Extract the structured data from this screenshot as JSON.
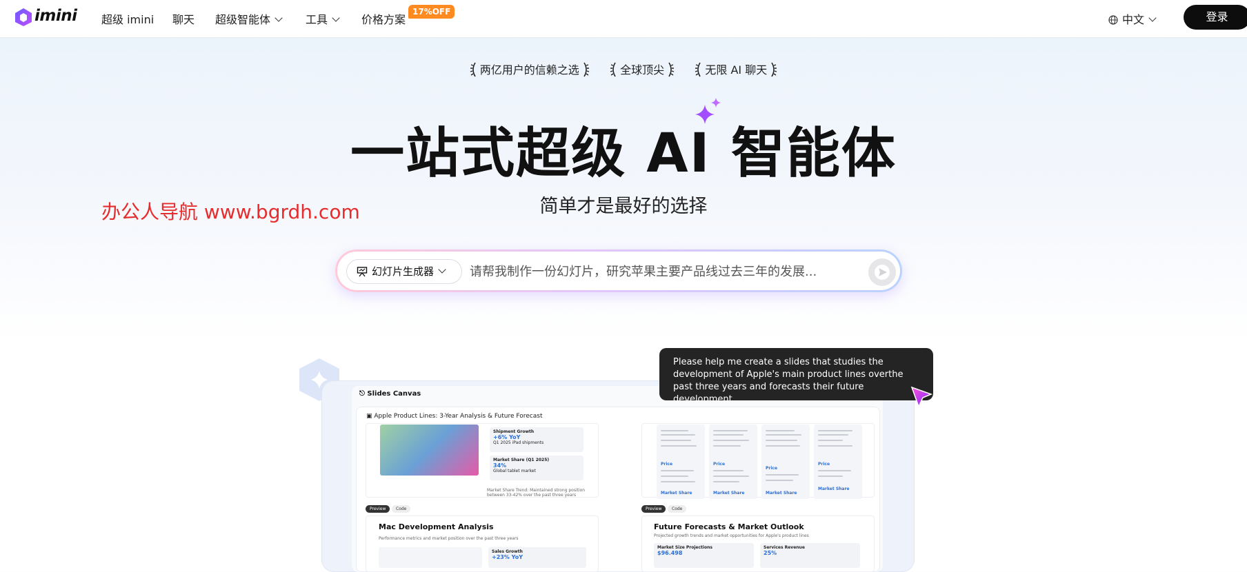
{
  "header": {
    "logo_text": "imini",
    "nav": [
      {
        "label": "超级 imini",
        "has_dropdown": false
      },
      {
        "label": "聊天",
        "has_dropdown": false
      },
      {
        "label": "超级智能体",
        "has_dropdown": true
      },
      {
        "label": "工具",
        "has_dropdown": true
      },
      {
        "label": "价格方案",
        "has_dropdown": false
      }
    ],
    "pricing_badge": "17%OFF",
    "language": "中文",
    "login_label": "登录"
  },
  "hero": {
    "tags": [
      "两亿用户的信赖之选",
      "全球顶尖",
      "无限 AI 聊天"
    ],
    "title": "一站式超级 AI 智能体",
    "subtitle": "简单才是最好的选择"
  },
  "watermark": "办公人导航  www.bgrdh.com",
  "search": {
    "agent_label": "幻灯片生成器",
    "placeholder": "请帮我制作一份幻灯片，研究苹果主要产品线过去三年的发展..."
  },
  "preview": {
    "canvas_title": "Slides Canvas",
    "doc_title": "Apple Product Lines: 3-Year Analysis & Future Forecast",
    "stats": [
      {
        "label": "Shipment Growth",
        "value": "+6% YoY",
        "note": "Q1 2025 iPad shipments"
      },
      {
        "label": "Market Share (Q1 2025)",
        "value": "34%",
        "note": "Global tablet market"
      }
    ],
    "trend_note": "Market Share Trend: Maintained strong position between 33-42% over the past three years",
    "tabs": [
      "Preview",
      "Code"
    ],
    "sections": [
      {
        "title": "Mac Development Analysis",
        "subtitle": "Performance metrics and market position over the past three years",
        "stat_label": "Sales Growth",
        "stat_value": "+23% YoY"
      },
      {
        "title": "Future Forecasts & Market Outlook",
        "subtitle": "Projected growth trends and market opportunities for Apple's product lines",
        "stat_label": "Market Size Projections",
        "stat_value": "$96.498",
        "stat2_label": "Services Revenue",
        "stat2_value": "25%"
      }
    ],
    "columns": [
      {
        "heading": "Price",
        "sub": "Market Share"
      },
      {
        "heading": "Price",
        "sub": "Market Share"
      },
      {
        "heading": "Price",
        "sub": "Market Share"
      },
      {
        "heading": "Price",
        "sub": "Market Share"
      }
    ]
  },
  "tooltip": "Please help me create a slides that studies the development of Apple's main product lines overthe past three years and forecasts their future development.",
  "colors": {
    "accent": "#8b3dff",
    "badge": "#ff8a1f",
    "watermark": "#e62c2c"
  }
}
